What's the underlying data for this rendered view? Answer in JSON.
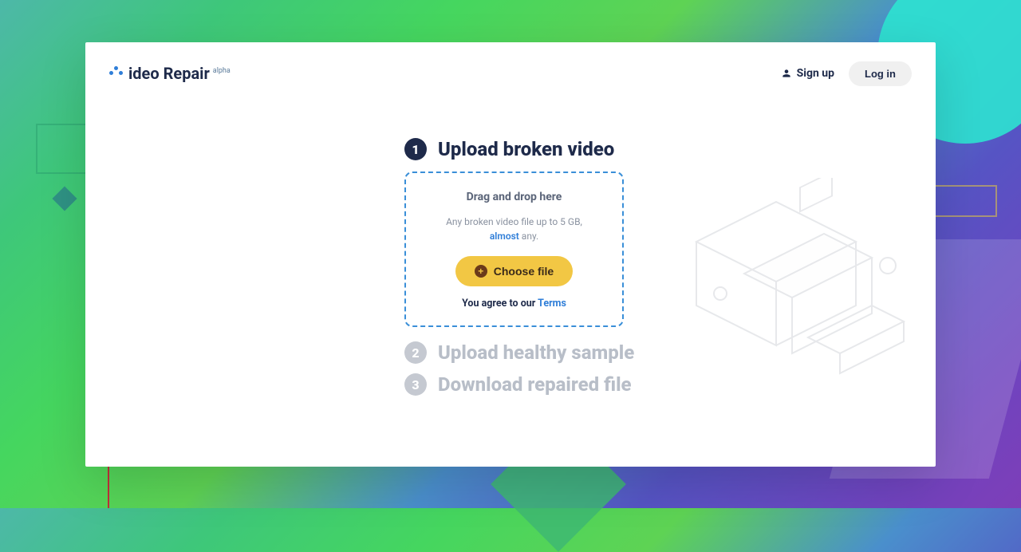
{
  "logo": {
    "brand": "ideo Repair",
    "super": "alpha"
  },
  "auth": {
    "signup": "Sign up",
    "login": "Log in"
  },
  "steps": {
    "s1": {
      "num": "1",
      "title": "Upload broken video"
    },
    "s2": {
      "num": "2",
      "title": "Upload healthy sample"
    },
    "s3": {
      "num": "3",
      "title": "Download repaired file"
    }
  },
  "dropzone": {
    "title": "Drag and drop here",
    "sub_pre": "Any broken video file up to 5 GB,",
    "sub_link": "almost",
    "sub_post": " any.",
    "choose": "Choose file",
    "agree_pre": "You agree to our ",
    "agree_link": "Terms"
  }
}
